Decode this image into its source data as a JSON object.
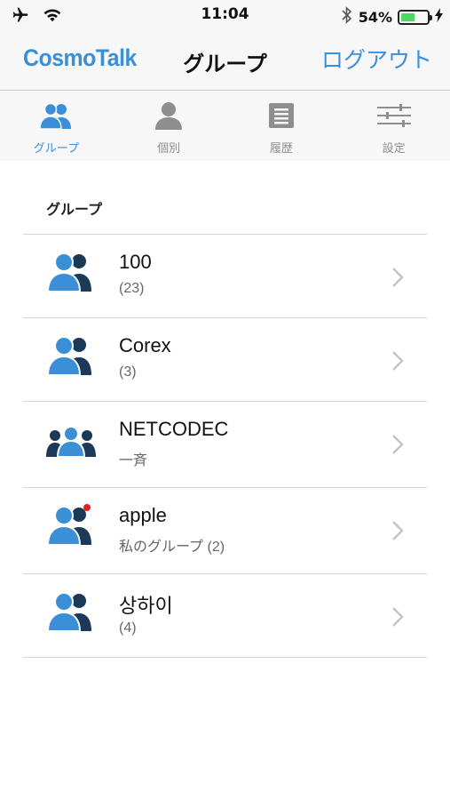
{
  "status_bar": {
    "time": "11:04",
    "battery_percent": "54%",
    "battery_level": 0.54
  },
  "nav": {
    "brand": "CosmoTalk",
    "title": "グループ",
    "logout_label": "ログアウト"
  },
  "tabs": [
    {
      "label": "グループ",
      "icon": "group-icon",
      "active": true
    },
    {
      "label": "個別",
      "icon": "person-icon",
      "active": false
    },
    {
      "label": "履歴",
      "icon": "history-icon",
      "active": false
    },
    {
      "label": "設定",
      "icon": "settings-icon",
      "active": false
    }
  ],
  "section": {
    "header": "グループ"
  },
  "groups": [
    {
      "title": "100",
      "subtitle": "(23)",
      "icon": "group-icon"
    },
    {
      "title": "Corex",
      "subtitle": "(3)",
      "icon": "group-icon"
    },
    {
      "title": "NETCODEC",
      "subtitle": "一斉",
      "icon": "broadcast-group-icon"
    },
    {
      "title": "apple",
      "subtitle": "私のグループ (2)",
      "icon": "group-unread-icon"
    },
    {
      "title": "상하이",
      "subtitle": "(4)",
      "icon": "group-icon"
    }
  ],
  "colors": {
    "accent": "#3a8fd6",
    "icon_dark": "#1b3a57",
    "tab_inactive": "#8e8e8e",
    "unread_dot": "#e02020",
    "battery_green": "#4cd964"
  }
}
